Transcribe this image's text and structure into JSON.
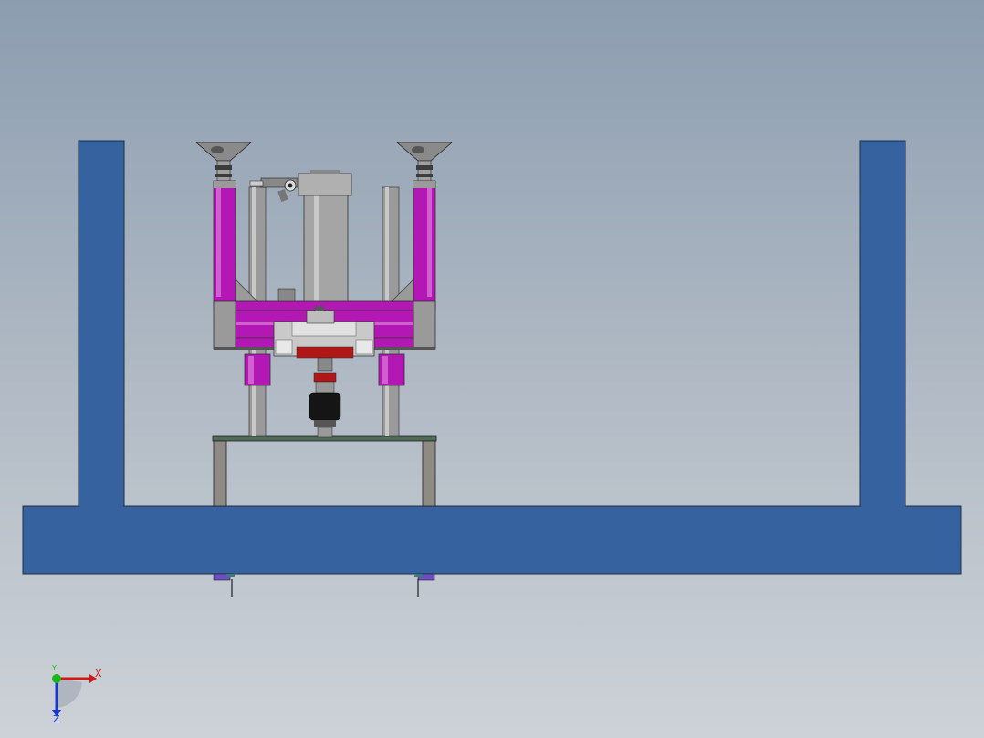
{
  "viewport": {
    "background_top": "#8c9db0",
    "background_bottom": "#cdd2d8"
  },
  "model": {
    "frame_color": "#3762a0",
    "frame_edge_color": "#1f2f45",
    "bracket_color": "#b418b4",
    "cylinder_color": "#a0a0a0",
    "plate_color": "#506a58",
    "accent_red": "#b01818"
  },
  "triad": {
    "x_label": "X",
    "y_label": "Y",
    "z_label": "Z",
    "x_color": "#d01818",
    "y_color": "#18b818",
    "z_color": "#1838d0"
  }
}
